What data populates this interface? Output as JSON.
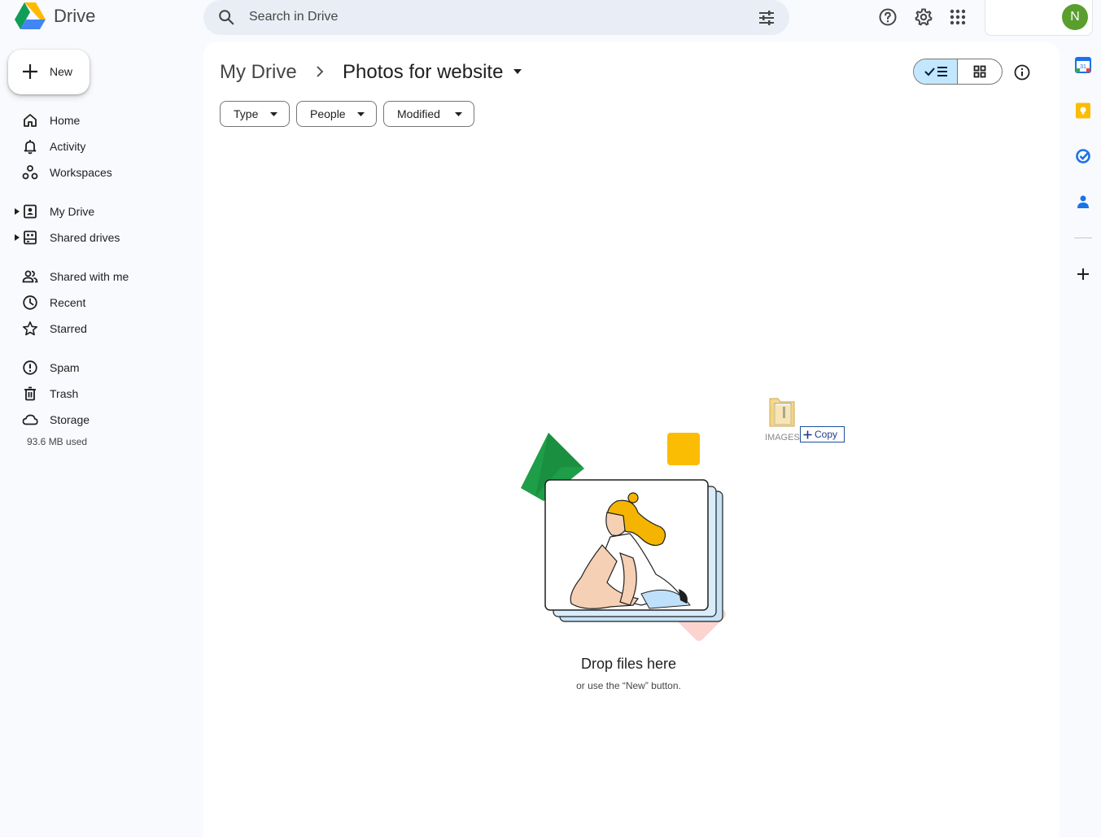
{
  "app": {
    "name": "Drive"
  },
  "search": {
    "placeholder": "Search in Drive"
  },
  "account": {
    "initial": "N",
    "avatar_color": "#5a9e2e"
  },
  "new_button": {
    "label": "New"
  },
  "sidebar": {
    "items": [
      {
        "label": "Home",
        "icon": "home-icon"
      },
      {
        "label": "Activity",
        "icon": "bell-icon"
      },
      {
        "label": "Workspaces",
        "icon": "workspaces-icon"
      },
      {
        "label": "My Drive",
        "icon": "my-drive-icon"
      },
      {
        "label": "Shared drives",
        "icon": "shared-drives-icon"
      },
      {
        "label": "Shared with me",
        "icon": "people-icon"
      },
      {
        "label": "Recent",
        "icon": "clock-icon"
      },
      {
        "label": "Starred",
        "icon": "star-icon"
      },
      {
        "label": "Spam",
        "icon": "spam-icon"
      },
      {
        "label": "Trash",
        "icon": "trash-icon"
      },
      {
        "label": "Storage",
        "icon": "cloud-icon"
      }
    ],
    "storage_used": "93.6 MB used"
  },
  "breadcrumb": {
    "root": "My Drive",
    "current": "Photos for website"
  },
  "filters": [
    {
      "label": "Type"
    },
    {
      "label": "People"
    },
    {
      "label": "Modified"
    }
  ],
  "empty_state": {
    "title": "Drop files here",
    "subtitle": "or use the “New” button."
  },
  "drag": {
    "item_name": "IMAGES",
    "action_label": "Copy"
  },
  "colors": {
    "accent": "#0b57d0",
    "selected": "#c2e7ff",
    "background": "#f8fafd",
    "search_bg": "#e9eef6"
  }
}
